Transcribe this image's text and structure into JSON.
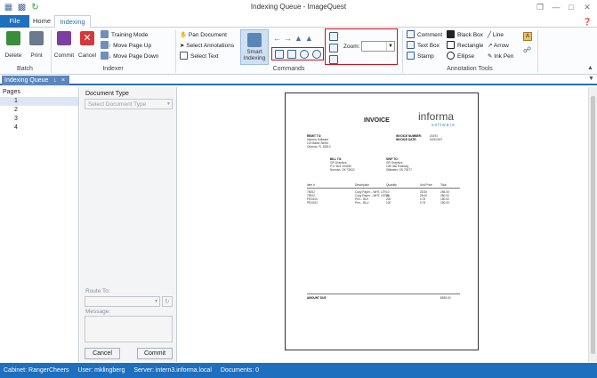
{
  "window": {
    "title": "Indexing Queue - ImageQuest"
  },
  "tabs": {
    "file": "File",
    "home": "Home",
    "indexing": "Indexing"
  },
  "ribbon": {
    "batch": {
      "label": "Batch",
      "delete": "Delete",
      "print": "Print"
    },
    "indexer": {
      "label": "Indexer",
      "commit": "Commit",
      "cancel": "Cancel",
      "training_mode": "Training Mode",
      "move_page_up": "Move Page Up",
      "move_page_down": "Move Page Down"
    },
    "commands": {
      "label": "Commands",
      "pan_document": "Pan Document",
      "select_annotations": "Select Annotations",
      "select_text": "Select Text",
      "smart_indexing_1": "Smart",
      "smart_indexing_2": "Indexing",
      "zoom_label": "Zoom:",
      "zoom_value": ""
    },
    "annotation_tools": {
      "label": "Annotation Tools",
      "comment": "Comment",
      "text_box": "Text Box",
      "stamp": "Stamp",
      "black_box": "Black Box",
      "rectangle": "Rectangle",
      "ellipse": "Ellipse",
      "line": "Line",
      "arrow": "Arrow",
      "ink_pen": "Ink Pen"
    }
  },
  "doc_tab": {
    "label": "Indexing Queue",
    "pin": "↓",
    "close": "×"
  },
  "pages_panel": {
    "title": "Pages",
    "pages": [
      "1",
      "2",
      "3",
      "4"
    ]
  },
  "index_panel": {
    "document_type_label": "Document Type",
    "document_type_placeholder": "Select Document Type",
    "route_to_label": "Route To:",
    "message_label": "Message:",
    "cancel_button": "Cancel",
    "commit_button": "Commit"
  },
  "document": {
    "title": "INVOICE",
    "logo_top": "informa",
    "logo_bottom": "software",
    "remit_to_label": "REMIT TO:",
    "remit_to": [
      "Informa Software",
      "123 Baker Street",
      "Orlando, FL 32810"
    ],
    "invoice_number_label": "INVOICE NUMBER:",
    "invoice_number": "20193",
    "invoice_date_label": "INVOICE DATE:",
    "invoice_date": "5/15/2007",
    "bill_to_label": "BILL TO:",
    "bill_to": [
      "GR Graphics",
      "P.O. Box 100250",
      "Norman, OK 73632"
    ],
    "ship_to_label": "SHIP TO:",
    "ship_to": [
      "GR Graphics",
      "105 Oak Parkway",
      "Stillwater, OK 73077"
    ],
    "columns": [
      "Item #",
      "Description",
      "Quantity",
      "Unit Price",
      "Total"
    ],
    "rows": [
      [
        "75002",
        "Copy Paper – WHT, LTR",
        "10",
        "25.50",
        "255.00"
      ],
      [
        "75002",
        "Copy Paper – WHT, LEGAL",
        "10",
        "28.00",
        "280.00"
      ],
      [
        "PEN100",
        "Pen – BLK",
        "200",
        "0.75",
        "150.00"
      ],
      [
        "PEN102",
        "Pen – BLU",
        "100",
        "0.75",
        "150.00"
      ]
    ],
    "amount_due_label": "AMOUNT DUE",
    "amount_due": "$835.00"
  },
  "status": {
    "cabinet": "Cabinet: RangerCheers",
    "user": "User: mklingberg",
    "server": "Server: intern3.informa.local",
    "documents": "Documents: 0"
  },
  "colors": {
    "accent": "#1e6fbe",
    "highlight": "#c4161c",
    "tab_active": "#5c87bd"
  }
}
